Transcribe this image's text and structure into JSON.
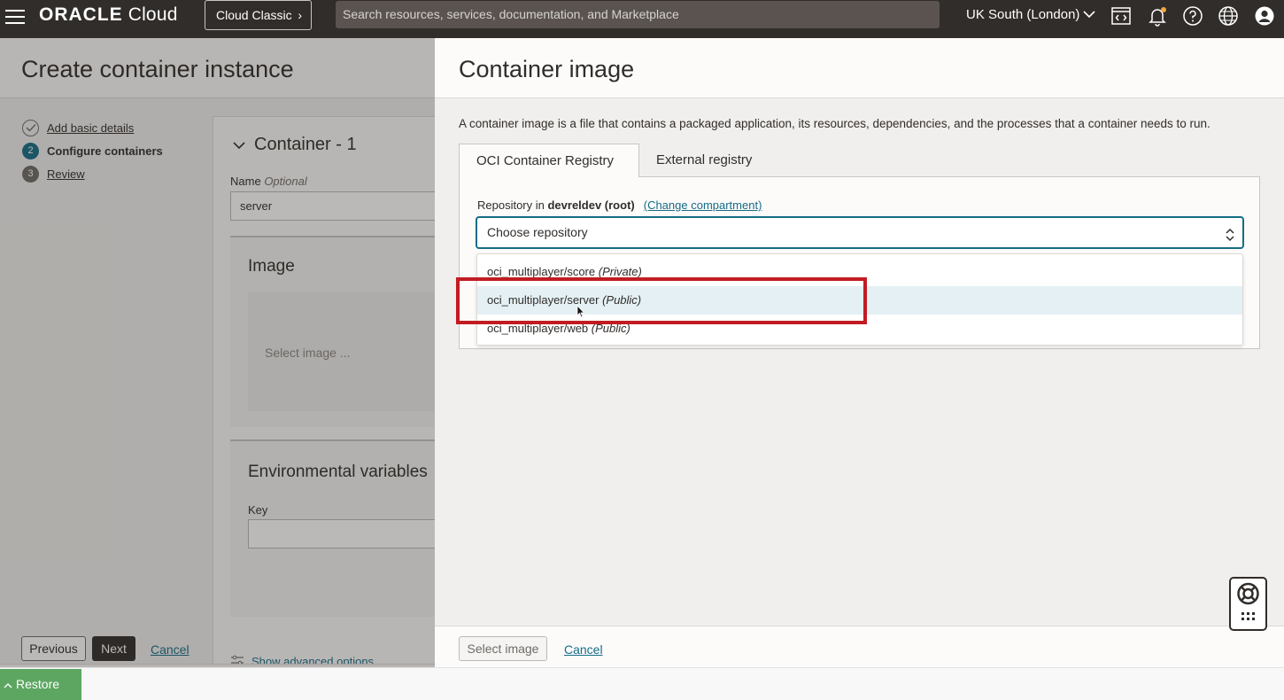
{
  "topbar": {
    "brand_main": "ORACLE",
    "brand_sub": " Cloud",
    "classic_label": "Cloud Classic",
    "search_placeholder": "Search resources, services, documentation, and Marketplace",
    "region": "UK South (London)",
    "icons": [
      "menu-icon",
      "code-editor-icon",
      "bell-icon",
      "help-icon",
      "globe-icon",
      "user-icon"
    ]
  },
  "wizard": {
    "title": "Create container instance",
    "steps": [
      {
        "number": "",
        "label": "Add basic details"
      },
      {
        "number": "2",
        "label": "Configure containers"
      },
      {
        "number": "3",
        "label": "Review"
      }
    ],
    "container": {
      "heading": "Container - 1",
      "name_label": "Name",
      "name_optional": "Optional",
      "name_value": "server",
      "image_heading": "Image",
      "image_placeholder": "Select image ...",
      "env_heading": "Environmental variables",
      "key_label": "Key",
      "advanced_link": "Show advanced options"
    },
    "footer": {
      "previous": "Previous",
      "next": "Next",
      "cancel": "Cancel"
    }
  },
  "drawer": {
    "title": "Container image",
    "description": "A container image is a file that contains a packaged application, its resources, dependencies, and the processes that a container needs to run.",
    "tabs": [
      {
        "label": "OCI Container Registry",
        "active": true
      },
      {
        "label": "External registry",
        "active": false
      }
    ],
    "repo_label_prefix": "Repository in ",
    "repo_compartment": "devreldev (root)",
    "change_compartment": "(Change compartment)",
    "select_placeholder": "Choose repository",
    "options": [
      {
        "name": "oci_multiplayer/score",
        "visibility": "(Private)"
      },
      {
        "name": "oci_multiplayer/server",
        "visibility": "(Public)"
      },
      {
        "name": "oci_multiplayer/web",
        "visibility": "(Public)"
      }
    ],
    "footer": {
      "select": "Select image",
      "cancel": "Cancel"
    }
  },
  "restore_label": "Restore",
  "colors": {
    "accent": "#166c86",
    "highlight": "#c21c22",
    "topbar": "#312d2a",
    "restore": "#5da662"
  }
}
